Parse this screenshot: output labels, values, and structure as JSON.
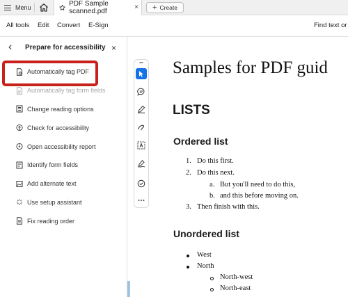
{
  "tabbar": {
    "menu_label": "Menu",
    "tab_title": "PDF Sample scanned.pdf",
    "tab_close": "×",
    "create_label": "Create"
  },
  "menubar": {
    "items": [
      "All tools",
      "Edit",
      "Convert",
      "E-Sign"
    ],
    "find_label": "Find text or to"
  },
  "panel": {
    "back": "‹",
    "title": "Prepare for accessibility",
    "close": "×",
    "items": [
      {
        "label": "Automatically tag PDF",
        "icon": "tag-pdf-icon",
        "state": "highlighted"
      },
      {
        "label": "Automatically tag form fields",
        "icon": "tag-form-icon",
        "state": "disabled"
      },
      {
        "label": "Change reading options",
        "icon": "reading-options-icon",
        "state": "normal"
      },
      {
        "label": "Check for accessibility",
        "icon": "accessibility-check-icon",
        "state": "normal"
      },
      {
        "label": "Open accessibility report",
        "icon": "report-icon",
        "state": "normal"
      },
      {
        "label": "Identify form fields",
        "icon": "form-fields-icon",
        "state": "normal"
      },
      {
        "label": "Add alternate text",
        "icon": "alt-text-icon",
        "state": "normal"
      },
      {
        "label": "Use setup assistant",
        "icon": "setup-assistant-icon",
        "state": "normal"
      },
      {
        "label": "Fix reading order",
        "icon": "reading-order-icon",
        "state": "normal"
      }
    ]
  },
  "rail": {
    "tools": [
      "select-icon",
      "comment-icon",
      "highlight-icon",
      "draw-icon",
      "text-select-icon",
      "sign-icon",
      "check-icon",
      "more-icon"
    ]
  },
  "document": {
    "title": "Samples for PDF guid",
    "section": "LISTS",
    "ordered_heading": "Ordered list",
    "ordered": {
      "n1": "1.",
      "t1": "Do this first.",
      "n2": "2.",
      "t2": "Do this next.",
      "na": "a.",
      "ta": "But you'll need to do this,",
      "nb": "b.",
      "tb": "and this before moving on.",
      "n3": "3.",
      "t3": "Then finish with this."
    },
    "unordered_heading": "Unordered list",
    "unordered": {
      "u1": "West",
      "u2": "North",
      "u3": "North-west",
      "u4": "North-east"
    }
  },
  "colors": {
    "highlight_box": "#c8201b",
    "active_tool": "#1473e6"
  }
}
